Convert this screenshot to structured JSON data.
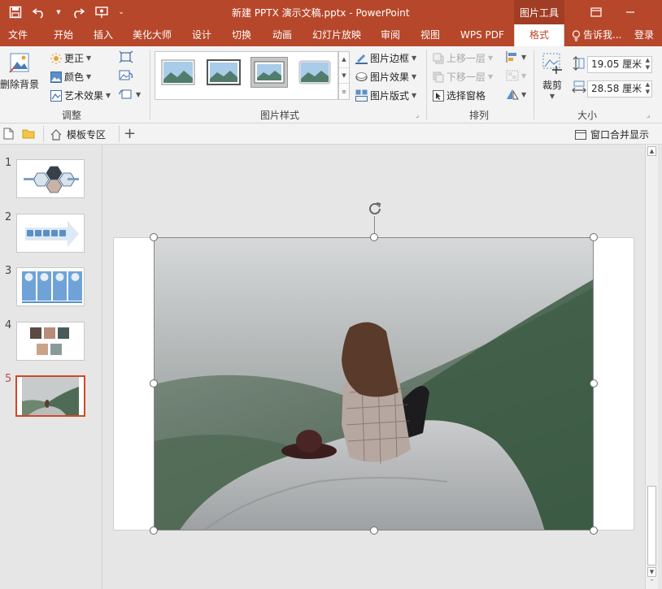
{
  "titlebar": {
    "doc_title": "新建 PPTX 演示文稿.pptx - PowerPoint",
    "context_tab_header": "图片工具"
  },
  "tabs": [
    "文件",
    "开始",
    "插入",
    "美化大师",
    "设计",
    "切换",
    "动画",
    "幻灯片放映",
    "审阅",
    "视图",
    "WPS PDF",
    "格式"
  ],
  "active_tab": "格式",
  "tell_me": "告诉我...",
  "login": "登录",
  "ribbon": {
    "adjust": {
      "remove_bg": "删除背景",
      "corrections": "更正",
      "color": "颜色",
      "artistic": "艺术效果",
      "label": "调整"
    },
    "styles": {
      "border": "图片边框",
      "effects": "图片效果",
      "layout": "图片版式",
      "label": "图片样式"
    },
    "arrange": {
      "bring_forward": "上移一层",
      "send_backward": "下移一层",
      "selection_pane": "选择窗格",
      "label": "排列"
    },
    "size": {
      "crop": "裁剪",
      "height": "19.05 厘米",
      "width": "28.58 厘米",
      "label": "大小"
    }
  },
  "template_bar": {
    "template_zone": "模板专区",
    "window_merge": "窗口合并显示"
  },
  "slides": [
    "1",
    "2",
    "3",
    "4",
    "5"
  ],
  "active_slide": "5",
  "colors": {
    "brand": "#b7472a",
    "active_slide_border": "#d24726"
  }
}
